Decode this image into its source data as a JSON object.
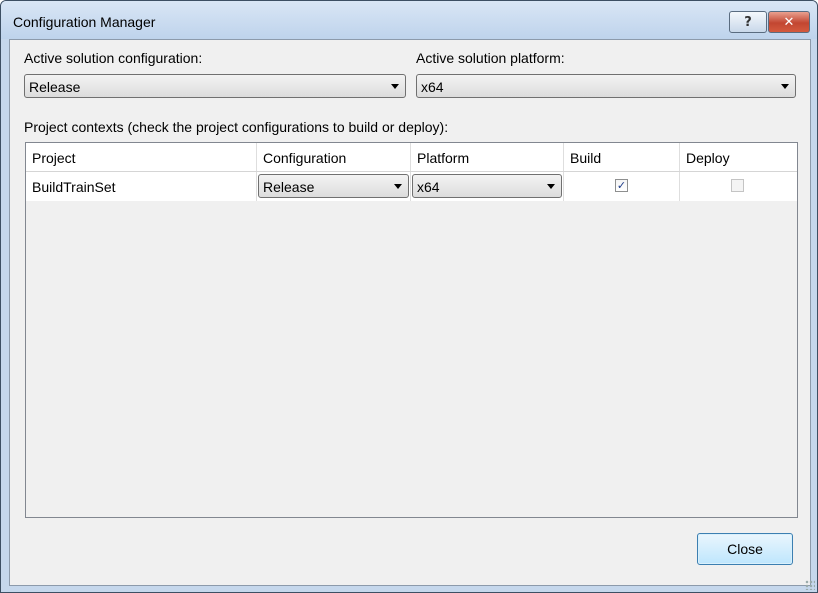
{
  "window": {
    "title": "Configuration Manager",
    "help_glyph": "?",
    "close_glyph": "✕"
  },
  "solution": {
    "config_label": "Active solution configuration:",
    "config_value": "Release",
    "platform_label": "Active solution platform:",
    "platform_value": "x64"
  },
  "contexts_label": "Project contexts (check the project configurations to build or deploy):",
  "grid": {
    "columns": [
      "Project",
      "Configuration",
      "Platform",
      "Build",
      "Deploy"
    ],
    "rows": [
      {
        "project": "BuildTrainSet",
        "configuration": "Release",
        "platform": "x64",
        "build_checked": true,
        "build_mark": "✓",
        "deploy_checked": false
      }
    ]
  },
  "buttons": {
    "close_label": "Close"
  },
  "icons": {
    "help": "help-icon",
    "close": "close-icon",
    "dropdown": "chevron-down-icon",
    "check": "checkmark-icon"
  },
  "colors": {
    "titlebar": "#bed3ec",
    "client": "#f0f0f0",
    "close_button": "#c24631",
    "default_button_border": "#3c7fb1"
  }
}
